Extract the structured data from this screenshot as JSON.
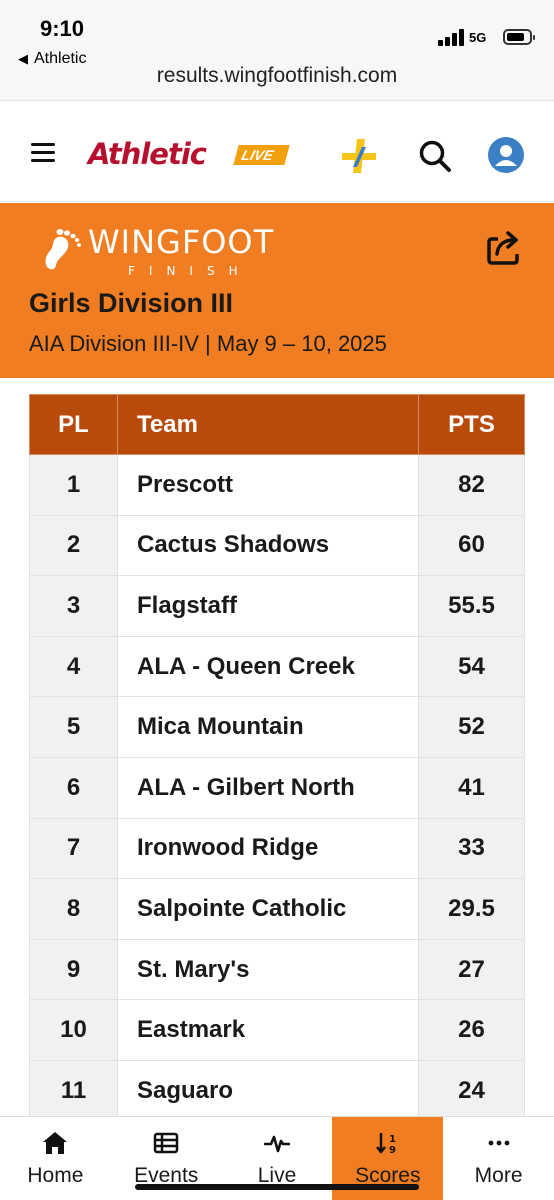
{
  "status_bar": {
    "time": "9:10",
    "back_app": "Athletic",
    "network": "5G",
    "url": "results.wingfootfinish.com"
  },
  "header": {
    "logo_text": "Athletic",
    "logo_badge": "LIVE",
    "brand_color": "#b7102e",
    "accent_color": "#f4a00b",
    "icons": [
      "menu-icon",
      "plus-icon",
      "search-icon",
      "account-icon"
    ]
  },
  "banner": {
    "background_color": "#f07d22",
    "logo_word": "WINGFOOT",
    "logo_sub": "FINISH",
    "title": "Girls Division III",
    "subtitle": "AIA Division III-IV | May 9 – 10, 2025"
  },
  "table": {
    "header_color": "#b84a0c",
    "columns": [
      "PL",
      "Team",
      "PTS"
    ],
    "rows": [
      {
        "pl": "1",
        "team": "Prescott",
        "pts": "82"
      },
      {
        "pl": "2",
        "team": "Cactus Shadows",
        "pts": "60"
      },
      {
        "pl": "3",
        "team": "Flagstaff",
        "pts": "55.5"
      },
      {
        "pl": "4",
        "team": "ALA - Queen Creek",
        "pts": "54"
      },
      {
        "pl": "5",
        "team": "Mica Mountain",
        "pts": "52"
      },
      {
        "pl": "6",
        "team": "ALA - Gilbert North",
        "pts": "41"
      },
      {
        "pl": "7",
        "team": "Ironwood Ridge",
        "pts": "33"
      },
      {
        "pl": "8",
        "team": "Salpointe Catholic",
        "pts": "29.5"
      },
      {
        "pl": "9",
        "team": "St. Mary's",
        "pts": "27"
      },
      {
        "pl": "10",
        "team": "Eastmark",
        "pts": "26"
      },
      {
        "pl": "11",
        "team": "Saguaro",
        "pts": "24"
      }
    ]
  },
  "tabbar": {
    "tabs": [
      {
        "label": "Home",
        "icon": "home-icon",
        "active": false
      },
      {
        "label": "Events",
        "icon": "events-icon",
        "active": false
      },
      {
        "label": "Live",
        "icon": "live-icon",
        "active": false
      },
      {
        "label": "Scores",
        "icon": "scores-icon",
        "active": true
      },
      {
        "label": "More",
        "icon": "more-icon",
        "active": false
      }
    ]
  }
}
